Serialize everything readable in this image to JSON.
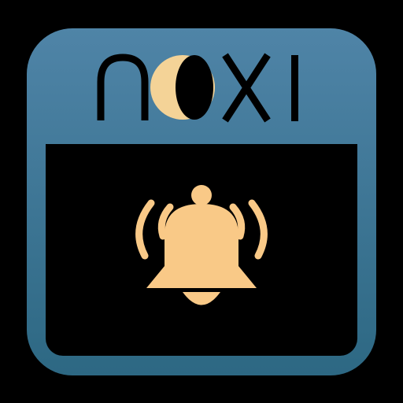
{
  "logo": {
    "wordmark": "noxi"
  },
  "colors": {
    "background": "#000000",
    "frame_top": "#4d82a5",
    "frame_bottom": "#2f6a86",
    "screen": "#000000",
    "outline": "#000000",
    "accent_gold": "#f9c987",
    "moon_light": "#f6d89b",
    "moon_dark": "#000000"
  },
  "icons": {
    "primary": "bell-ringing-icon",
    "logo_o": "crescent-moon-icon"
  }
}
